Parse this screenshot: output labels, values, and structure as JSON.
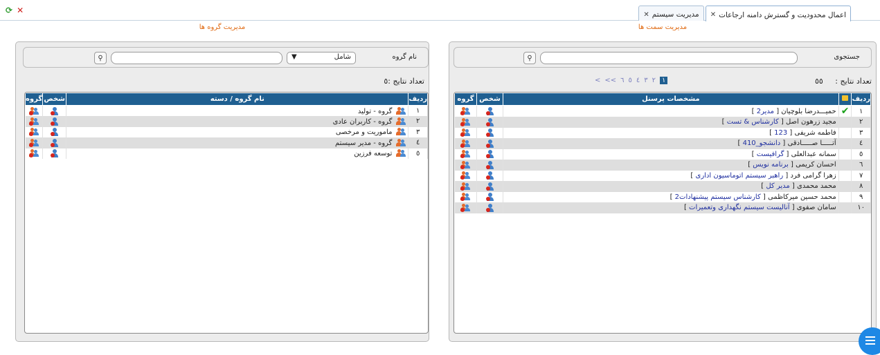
{
  "tabs": [
    {
      "label": "مدیریت سیستم",
      "active": false
    },
    {
      "label": "اعمال محدودیت و گسترش دامنه ارجاعات",
      "active": true
    }
  ],
  "colors": {
    "accent": "#1f5f91",
    "title": "#e06a12"
  },
  "right_panel": {
    "title": "مدیریت سمت ها",
    "search_label": "جستجوی",
    "search_value": "",
    "count_label": "تعداد نتایج :",
    "count_value": "٥٥",
    "pager": [
      "١",
      "٢",
      "٣",
      "٤",
      "٥",
      "٦",
      ">>",
      ">"
    ],
    "columns": [
      "ردیف",
      "",
      "مشخصات پرسنل",
      "شخص",
      "گروه"
    ],
    "rows": [
      {
        "n": "١",
        "name": "حمیـــدرضا بلوچیان",
        "role": "مدیر2",
        "checked": true
      },
      {
        "n": "٢",
        "name": "مجید زرهون اصل",
        "role": "کارشناس & تست",
        "checked": false
      },
      {
        "n": "٣",
        "name": "فاطمه شریفی",
        "role": "123",
        "checked": false
      },
      {
        "n": "٤",
        "name": "آتـــــا صـــــادقی",
        "role": "دانشجو_410",
        "checked": false
      },
      {
        "n": "٥",
        "name": "سمانه عبدالعلی",
        "role": "گرافیست",
        "checked": false
      },
      {
        "n": "٦",
        "name": "احسان کریمی",
        "role": "برنامه نویس",
        "checked": false
      },
      {
        "n": "٧",
        "name": "زهرا گرامی فرد",
        "role": "راهبر سیستم اتوماسیون اداری",
        "checked": false
      },
      {
        "n": "٨",
        "name": "محمد محمدی",
        "role": "مدیر کل",
        "checked": false
      },
      {
        "n": "٩",
        "name": "محمد حسین میرکاظمی",
        "role": "کارشناس سیستم پیشنهادات2",
        "checked": false
      },
      {
        "n": "١٠",
        "name": "سامان صفوی",
        "role": "آنالیست سیستم نگهداری وتعمیرات",
        "checked": false
      }
    ]
  },
  "left_panel": {
    "title": "مدیریت گروه ها",
    "group_label": "نام گروه",
    "select_value": "شامل",
    "search_value": "",
    "count_label": "تعداد نتایج :٥",
    "columns": [
      "ردیف",
      "نام گروه / دسته",
      "شخص",
      "گروه"
    ],
    "rows": [
      {
        "n": "١",
        "name": "گروه - تولید"
      },
      {
        "n": "٢",
        "name": "گروه - کاربران عادی"
      },
      {
        "n": "٣",
        "name": "ماموریت و مرخصی"
      },
      {
        "n": "٤",
        "name": "گروه - مدیر سیستم"
      },
      {
        "n": "٥",
        "name": "توسعه فرزین"
      }
    ]
  }
}
